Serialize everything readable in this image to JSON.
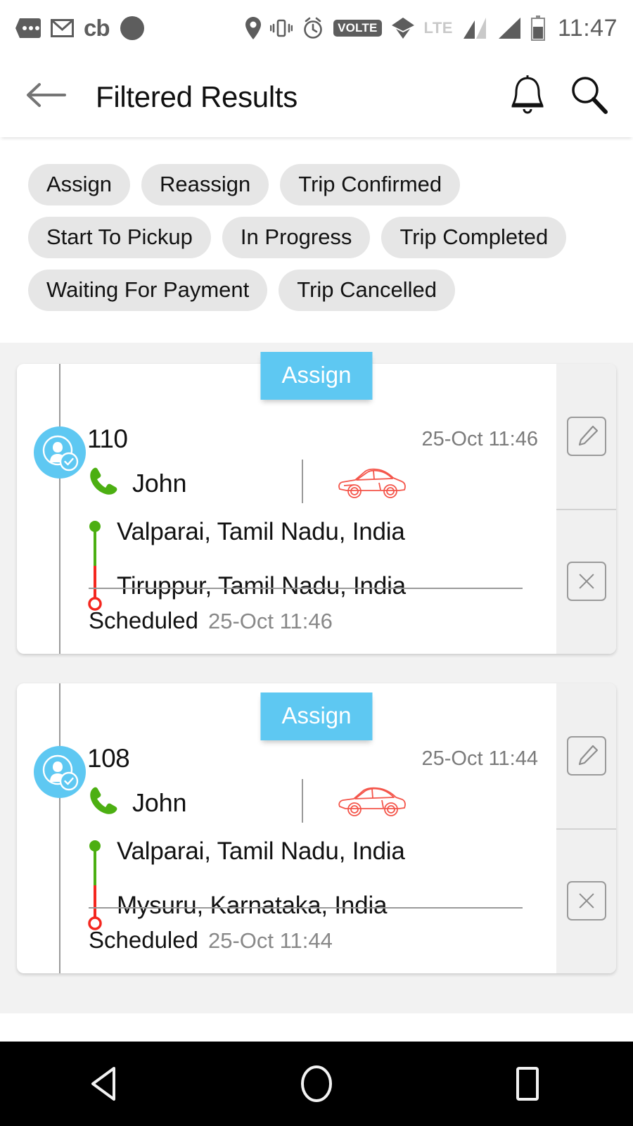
{
  "status_bar": {
    "icons": [
      "chat-dots-icon",
      "gmail-icon",
      "cb-icon",
      "circle-icon",
      "location-pin-icon",
      "vibrate-icon",
      "alarm-icon",
      "volte-icon",
      "wifi-icon",
      "signal-1-icon",
      "signal-2-icon",
      "battery-icon"
    ],
    "volte_label": "VOLTE",
    "network_label": "LTE",
    "cb_label": "cb",
    "clock": "11:47"
  },
  "app_bar": {
    "back_icon": "arrow-left-icon",
    "title": "Filtered Results",
    "notification_icon": "bell-icon",
    "search_icon": "search-icon"
  },
  "filters": {
    "chips": [
      {
        "label": "Assign"
      },
      {
        "label": "Reassign"
      },
      {
        "label": "Trip Confirmed"
      },
      {
        "label": "Start To Pickup"
      },
      {
        "label": "In Progress"
      },
      {
        "label": "Trip Completed"
      },
      {
        "label": "Waiting For Payment"
      },
      {
        "label": "Trip Cancelled"
      }
    ]
  },
  "colors": {
    "accent_blue": "#5ec8f2",
    "pickup_green": "#4caf12",
    "drop_red": "#f4271f",
    "chip_bg": "#e6e6e6",
    "list_bg": "#f2f2f2"
  },
  "trips": [
    {
      "status_badge": "Assign",
      "avatar_icon": "user-verified-icon",
      "trip_id": "110",
      "created_time": "25-Oct 11:46",
      "phone_icon": "phone-icon",
      "driver_name": "John",
      "vehicle_icon": "car-icon",
      "pickup": "Valparai, Tamil Nadu, India",
      "drop": "Tiruppur, Tamil Nadu, India",
      "schedule_label": "Scheduled",
      "schedule_time": "25-Oct 11:46",
      "edit_icon": "edit-icon",
      "cancel_icon": "close-icon"
    },
    {
      "status_badge": "Assign",
      "avatar_icon": "user-verified-icon",
      "trip_id": "108",
      "created_time": "25-Oct 11:44",
      "phone_icon": "phone-icon",
      "driver_name": "John",
      "vehicle_icon": "car-icon",
      "pickup": "Valparai, Tamil Nadu, India",
      "drop": "Mysuru, Karnataka, India",
      "schedule_label": "Scheduled",
      "schedule_time": "25-Oct 11:44",
      "edit_icon": "edit-icon",
      "cancel_icon": "close-icon"
    }
  ],
  "nav_bar": {
    "back_icon": "nav-back-triangle-icon",
    "home_icon": "nav-home-circle-icon",
    "recents_icon": "nav-recents-square-icon"
  }
}
